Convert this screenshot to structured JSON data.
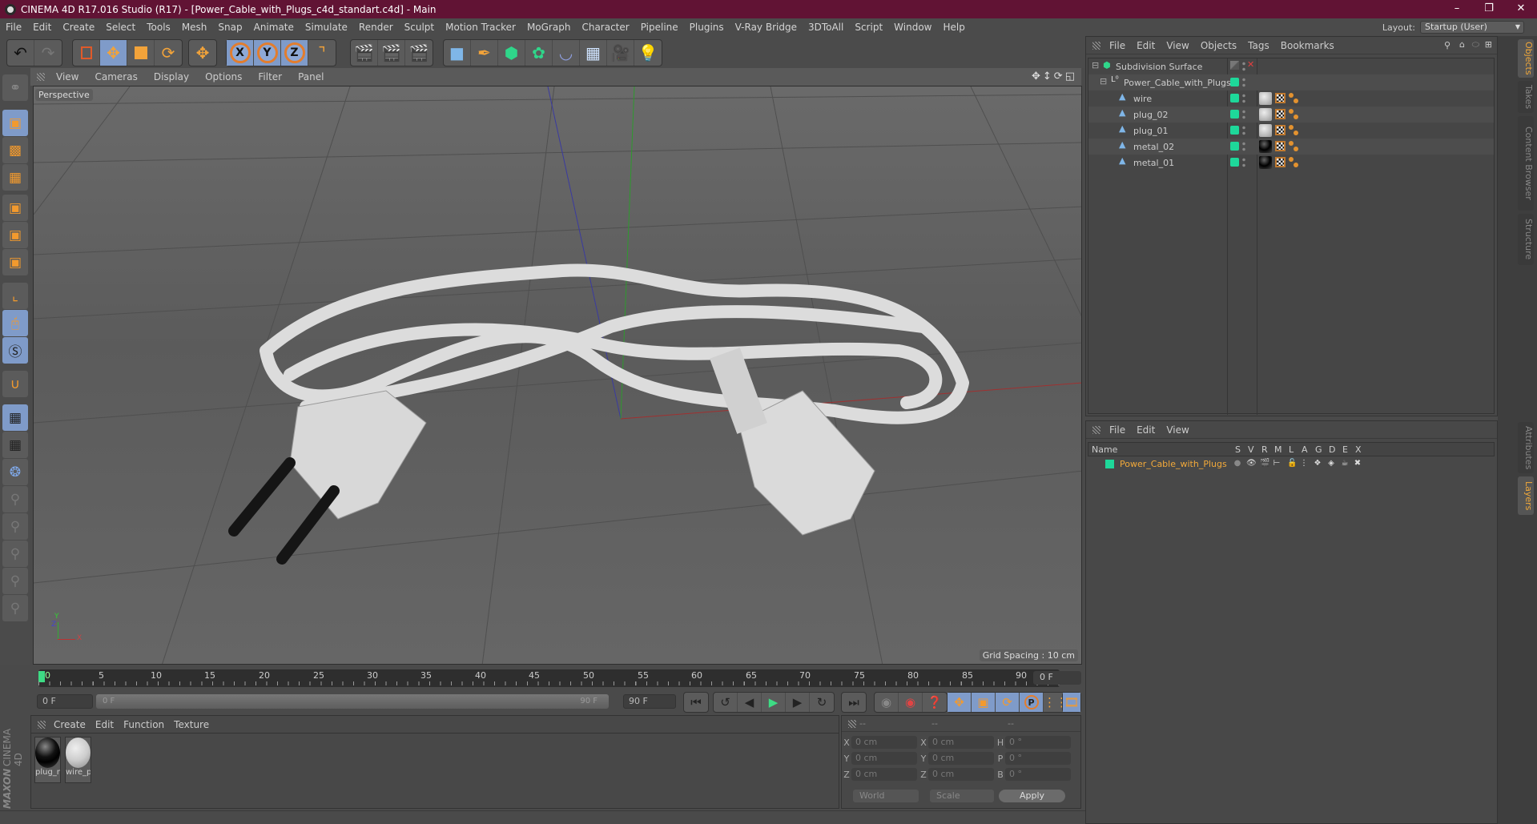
{
  "window": {
    "title": "CINEMA 4D R17.016 Studio (R17) - [Power_Cable_with_Plugs_c4d_standart.c4d] - Main",
    "controls": [
      "minimize-icon",
      "restore-icon",
      "close-icon"
    ]
  },
  "menubar": {
    "items": [
      "File",
      "Edit",
      "Create",
      "Select",
      "Tools",
      "Mesh",
      "Snap",
      "Animate",
      "Simulate",
      "Render",
      "Sculpt",
      "Motion Tracker",
      "MoGraph",
      "Character",
      "Pipeline",
      "Plugins",
      "V-Ray Bridge",
      "3DToAll",
      "Script",
      "Window",
      "Help"
    ],
    "layout_label": "Layout:",
    "layout_value": "Startup (User)"
  },
  "toolbar": {
    "groups": [
      [
        "undo-icon",
        "redo-icon"
      ],
      [
        "live-selection-icon",
        "move-icon",
        "scale-icon",
        "rotate-icon"
      ],
      [
        "transform-icon"
      ],
      [
        "x-axis-icon",
        "y-axis-icon",
        "z-axis-icon",
        "world-coordinates-icon"
      ],
      [
        "render-view-icon",
        "render-picture-viewer-icon",
        "render-settings-icon"
      ],
      [
        "cube-icon",
        "pen-spline-icon",
        "subdivision-surface-icon",
        "cloner-icon",
        "deformer-icon",
        "floor-icon",
        "camera-icon",
        "light-icon"
      ]
    ],
    "axis_labels": [
      "X",
      "Y",
      "Z"
    ]
  },
  "left_toolbar": {
    "items": [
      "make-editable-icon",
      "model-mode-icon",
      "texture-mode-icon",
      "workplane-mode-icon",
      "points-mode-icon",
      "edges-mode-icon",
      "polygons-mode-icon",
      "axis-mode-icon",
      "tweak-mode-icon",
      "solo-icon",
      "snap-icon",
      "locked-workplane-icon",
      "workplane-align-icon",
      "python-icon",
      "script-1-icon",
      "script-p-icon",
      "script-r-icon",
      "script-target-icon",
      "script-brush-icon"
    ]
  },
  "viewport": {
    "menu": [
      "View",
      "Cameras",
      "Display",
      "Options",
      "Filter",
      "Panel"
    ],
    "camera_label": "Perspective",
    "grid_spacing": "Grid Spacing : 10 cm",
    "axis_labels": {
      "x": "X",
      "y": "Y",
      "z": "Z"
    }
  },
  "timeline": {
    "ticks": [
      "0",
      "5",
      "10",
      "15",
      "20",
      "25",
      "30",
      "35",
      "40",
      "45",
      "50",
      "55",
      "60",
      "65",
      "70",
      "75",
      "80",
      "85",
      "90"
    ],
    "current_frame": "0 F",
    "start_frame": "0 F",
    "range_start": "0 F",
    "range_end": "90 F",
    "end_frame": "90 F"
  },
  "playback": {
    "buttons": [
      "go-to-start-icon",
      "previous-key-icon",
      "previous-frame-icon",
      "play-icon",
      "next-frame-icon",
      "next-key-icon",
      "go-to-end-icon",
      "record-key-icon",
      "auto-keying-icon",
      "keyframe-selection-icon",
      "move-key-icon",
      "scale-key-icon",
      "rotate-key-icon",
      "param-key-icon",
      "pla-key-icon",
      "timeline-icon"
    ],
    "param_label": "P"
  },
  "material_manager": {
    "menu": [
      "Create",
      "Edit",
      "Function",
      "Texture"
    ],
    "materials": [
      {
        "name": "plug_me",
        "type": "dark-glossy"
      },
      {
        "name": "wire_pla",
        "type": "light-matte"
      }
    ]
  },
  "coordinates": {
    "headers": [
      "--",
      "--",
      "--"
    ],
    "rows": [
      {
        "l1": "X",
        "v1": "0 cm",
        "l2": "X",
        "v2": "0 cm",
        "l3": "H",
        "v3": "0 °"
      },
      {
        "l1": "Y",
        "v1": "0 cm",
        "l2": "Y",
        "v2": "0 cm",
        "l3": "P",
        "v3": "0 °"
      },
      {
        "l1": "Z",
        "v1": "0 cm",
        "l2": "Z",
        "v2": "0 cm",
        "l3": "B",
        "v3": "0 °"
      }
    ],
    "space_dropdown": "World",
    "mode_dropdown": "Scale",
    "apply_label": "Apply"
  },
  "object_manager": {
    "menu": [
      "File",
      "Edit",
      "View",
      "Objects",
      "Tags",
      "Bookmarks"
    ],
    "objects": [
      {
        "name": "Subdivision Surface",
        "level": 0,
        "type": "subdivision"
      },
      {
        "name": "Power_Cable_with_Plugs",
        "level": 1,
        "type": "null"
      },
      {
        "name": "wire",
        "level": 2,
        "type": "polygon",
        "material": "light"
      },
      {
        "name": "plug_02",
        "level": 2,
        "type": "polygon",
        "material": "light"
      },
      {
        "name": "plug_01",
        "level": 2,
        "type": "polygon",
        "material": "light"
      },
      {
        "name": "metal_02",
        "level": 2,
        "type": "polygon",
        "material": "dark"
      },
      {
        "name": "metal_01",
        "level": 2,
        "type": "polygon",
        "material": "dark"
      }
    ]
  },
  "layer_manager": {
    "menu": [
      "File",
      "Edit",
      "View"
    ],
    "columns": [
      "Name",
      "S",
      "V",
      "R",
      "M",
      "L",
      "A",
      "G",
      "D",
      "E",
      "X"
    ],
    "layers": [
      {
        "name": "Power_Cable_with_Plugs",
        "color": "#1ed89a"
      }
    ]
  },
  "side_tabs": {
    "top": [
      {
        "label": "Objects",
        "active": true
      },
      {
        "label": "Takes",
        "active": false
      },
      {
        "label": "Content Browser",
        "active": false
      },
      {
        "label": "Structure",
        "active": false
      }
    ],
    "bottom": [
      {
        "label": "Attributes",
        "active": false
      },
      {
        "label": "Layers",
        "active": true
      }
    ]
  },
  "branding": {
    "maxon": "MAXON",
    "product": "CINEMA 4D"
  },
  "colors": {
    "titlebar": "#611334",
    "accent_orange": "#f2a33a",
    "active_blue": "#7f9bc9",
    "layer_green": "#1ed89a"
  }
}
